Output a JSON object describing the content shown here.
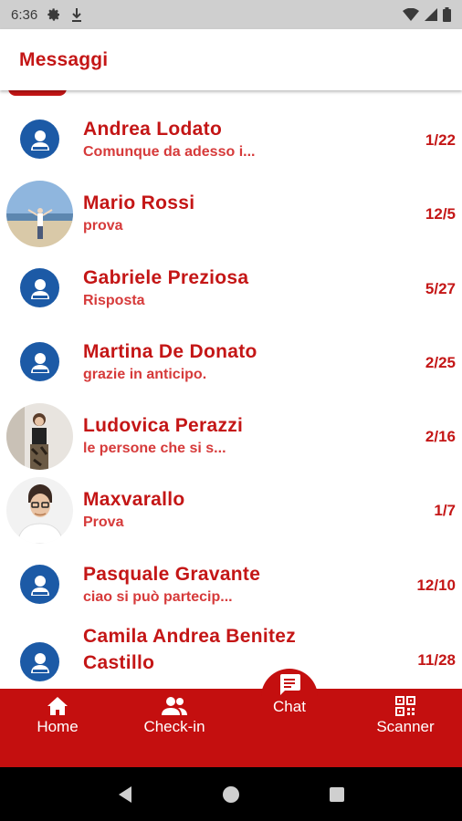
{
  "status_bar": {
    "time": "6:36"
  },
  "app_bar": {
    "title": "Messaggi"
  },
  "chats": [
    {
      "name": "Andrea Lodato",
      "preview": "Comunque da adesso i...",
      "date": "1/22",
      "avatar": "generic"
    },
    {
      "name": "Mario Rossi",
      "preview": "prova",
      "date": "12/5",
      "avatar": "photo-beach"
    },
    {
      "name": "Gabriele Preziosa",
      "preview": "Risposta",
      "date": "5/27",
      "avatar": "generic"
    },
    {
      "name": "Martina De Donato",
      "preview": "grazie in anticipo.",
      "date": "2/25",
      "avatar": "generic"
    },
    {
      "name": "Ludovica Perazzi",
      "preview": " le persone che si s...",
      "date": "2/16",
      "avatar": "photo-woman"
    },
    {
      "name": "Maxvarallo",
      "preview": "Prova",
      "date": "1/7",
      "avatar": "photo-man"
    },
    {
      "name": "Pasquale Gravante",
      "preview": "ciao si può partecip...",
      "date": "12/10",
      "avatar": "generic"
    },
    {
      "name_line1": "Camila Andrea Benitez",
      "name_line2": "Castillo",
      "date": "11/28",
      "avatar": "generic"
    }
  ],
  "bottom_nav": {
    "items": [
      {
        "label": "Home",
        "icon": "home-icon"
      },
      {
        "label": "Check-in",
        "icon": "people-icon"
      },
      {
        "label": "Chat",
        "icon": "chat-icon",
        "active": true
      },
      {
        "label": "Scanner",
        "icon": "qr-code-icon"
      }
    ]
  },
  "colors": {
    "brand_red": "#c41616",
    "nav_red": "#c40f0f",
    "avatar_blue": "#1c5aa6"
  }
}
